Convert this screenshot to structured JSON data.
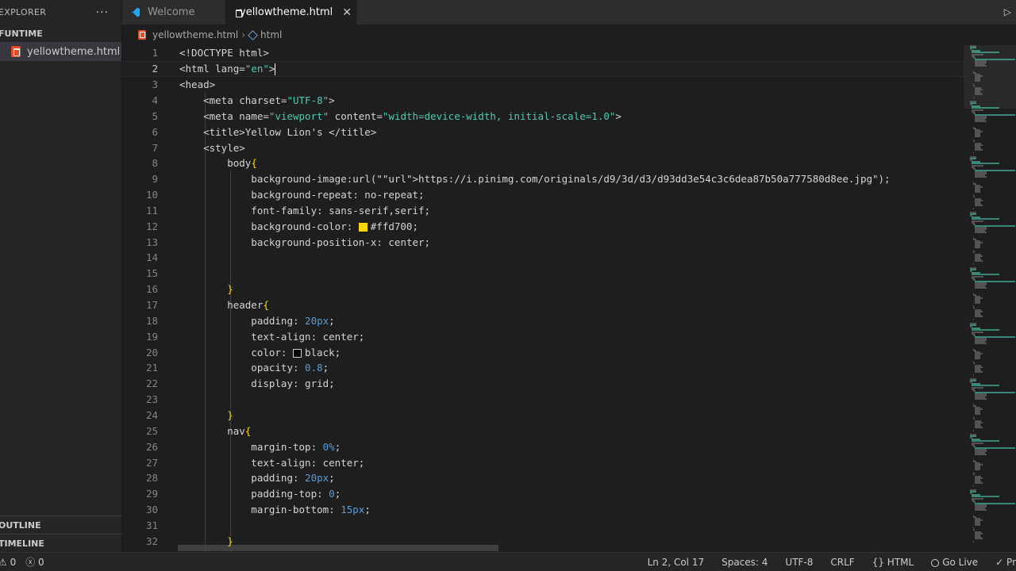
{
  "sidebar": {
    "title": "EXPLORER",
    "more": "···",
    "section": "FUNTIME",
    "file": "yellowtheme.html",
    "outline": "OUTLINE",
    "timeline": "TIMELINE"
  },
  "tabs": [
    {
      "label": "Welcome",
      "icon": "vscode-icon",
      "active": false
    },
    {
      "label": "yellowtheme.html",
      "icon": "html-file-icon",
      "active": true
    }
  ],
  "tab_close": "✕",
  "breadcrumb": {
    "file": "yellowtheme.html",
    "sep": "›",
    "node": "html"
  },
  "editor": {
    "lines": [
      {
        "n": "1",
        "text": "<!DOCTYPE html>"
      },
      {
        "n": "2",
        "text": "<html lang=\"en\">"
      },
      {
        "n": "3",
        "text": "<head>"
      },
      {
        "n": "4",
        "text": "    <meta charset=\"UTF-8\">"
      },
      {
        "n": "5",
        "text": "    <meta name=\"viewport\" content=\"width=device-width, initial-scale=1.0\">"
      },
      {
        "n": "6",
        "text": "    <title>Yellow Lion's </title>"
      },
      {
        "n": "7",
        "text": "    <style>"
      },
      {
        "n": "8",
        "text": "        body{"
      },
      {
        "n": "9",
        "text": "            background-image:url(\"https://i.pinimg.com/originals/d9/3d/d3/d93dd3e54c3c6dea87b50a777580d8ee.jpg\");"
      },
      {
        "n": "10",
        "text": "            background-repeat: no-repeat;"
      },
      {
        "n": "11",
        "text": "            font-family: sans-serif,serif;"
      },
      {
        "n": "12",
        "text": "            background-color: #ffd700;"
      },
      {
        "n": "13",
        "text": "            background-position-x: center;"
      },
      {
        "n": "14",
        "text": ""
      },
      {
        "n": "15",
        "text": ""
      },
      {
        "n": "16",
        "text": "        }"
      },
      {
        "n": "17",
        "text": "        header{"
      },
      {
        "n": "18",
        "text": "            padding: 20px;"
      },
      {
        "n": "19",
        "text": "            text-align: center;"
      },
      {
        "n": "20",
        "text": "            color: black;"
      },
      {
        "n": "21",
        "text": "            opacity: 0.8;"
      },
      {
        "n": "22",
        "text": "            display: grid;"
      },
      {
        "n": "23",
        "text": ""
      },
      {
        "n": "24",
        "text": "        }"
      },
      {
        "n": "25",
        "text": "        nav{"
      },
      {
        "n": "26",
        "text": "            margin-top: 0%;"
      },
      {
        "n": "27",
        "text": "            text-align: center;"
      },
      {
        "n": "28",
        "text": "            padding: 20px;"
      },
      {
        "n": "29",
        "text": "            padding-top: 0;"
      },
      {
        "n": "30",
        "text": "            margin-bottom: 15px;"
      },
      {
        "n": "31",
        "text": ""
      },
      {
        "n": "32",
        "text": "        }"
      }
    ],
    "current_line": 2,
    "colors": {
      "yellow_swatch": "#ffd700",
      "black_swatch": "#000000"
    }
  },
  "statusbar": {
    "errors": "⚠ 0",
    "warnings": "ⓧ 0",
    "position": "Ln 2, Col 17",
    "spaces": "Spaces: 4",
    "encoding": "UTF-8",
    "eol": "CRLF",
    "language": "HTML",
    "golive": "Go Live",
    "prettier": "✓ Pr"
  }
}
